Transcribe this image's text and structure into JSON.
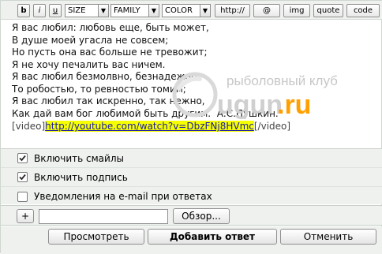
{
  "toolbar": {
    "bold": "b",
    "italic": "i",
    "underline": "u",
    "size_select": "SIZE",
    "family_select": "FAMILY",
    "color_select": "COLOR",
    "http": "http://",
    "at": "@",
    "img": "img",
    "quote": "quote",
    "code": "code"
  },
  "editor": {
    "lines": [
      "Я вас любил: любовь еще, быть может,",
      "В душе моей угасла не совсем;",
      "Но пусть она вас больше не тревожит;",
      "Я не хочу печалить вас ничем.",
      "Я вас любил безмолвно, безнадежно,",
      "То робостью, то ревностью томим;",
      "Я вас любил так искренно, так нежно,",
      "Как дай вам бог любимой быть другим.  А.С.Пушкин."
    ],
    "video_open": "[video]",
    "video_url": "http://youtube.com/watch?v=DbzFNj8HVmc",
    "video_close": "[/video]"
  },
  "watermark": {
    "tagline": "рыболовный клуб",
    "brand": "ugun",
    "domain": ".ru"
  },
  "options": {
    "smileys": {
      "label": "Включить смайлы",
      "checked": true
    },
    "signature": {
      "label": "Включить подпись",
      "checked": true
    },
    "email_notify": {
      "label": "Уведомления на e-mail при ответах",
      "checked": false
    }
  },
  "upload": {
    "plus_label": "+",
    "file_value": "",
    "browse_label": "Обзор..."
  },
  "actions": {
    "preview": "Просмотреть",
    "submit": "Добавить ответ",
    "cancel": "Отменить"
  },
  "colors": {
    "panel_bg": "#eef1ee",
    "highlight": "#f6ff00",
    "link": "#1a1aa6",
    "brand_orange": "#ffa000",
    "watermark_gray": "#c7c7c7"
  }
}
